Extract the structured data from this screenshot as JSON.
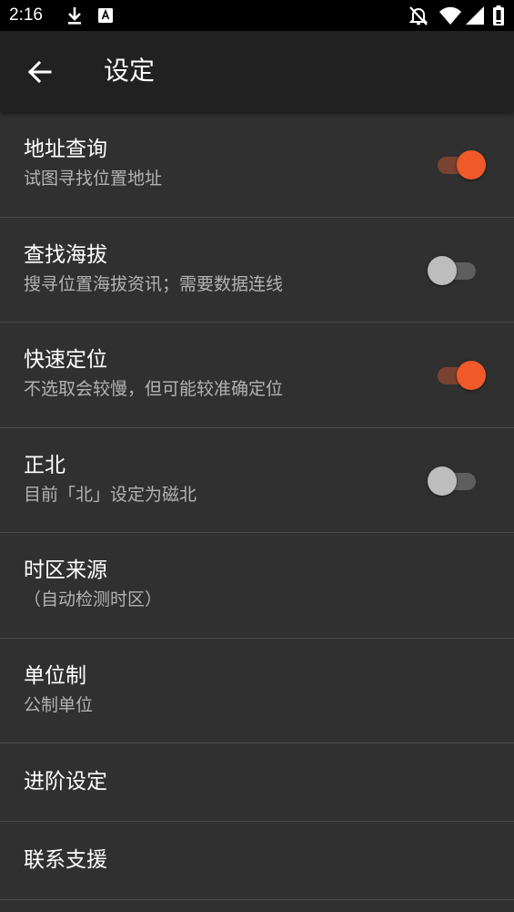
{
  "status_bar": {
    "time": "2:16",
    "left_icons": [
      "download-icon",
      "app-notification-icon"
    ],
    "right_icons": [
      "notifications-off-icon",
      "wifi-icon",
      "signal-icon",
      "battery-icon"
    ]
  },
  "app_bar": {
    "back_icon": "arrow-back-icon",
    "title": "设定"
  },
  "colors": {
    "accent": "#f0592a",
    "accent_track": "#7a4230",
    "background": "#303030",
    "app_bar": "#212121",
    "status_bar": "#000000",
    "divider": "#4a4a4a",
    "secondary_text": "#b3b3b3"
  },
  "settings": [
    {
      "title": "地址查询",
      "summary": "试图寻找位置地址",
      "toggle": true
    },
    {
      "title": "查找海拔",
      "summary": "搜寻位置海拔资讯；需要数据连线",
      "toggle": false
    },
    {
      "title": "快速定位",
      "summary": "不选取会较慢，但可能较准确定位",
      "toggle": true
    },
    {
      "title": "正北",
      "summary": "目前「北」设定为磁北",
      "toggle": false
    },
    {
      "title": "时区来源",
      "summary": "（自动检测时区）"
    },
    {
      "title": "单位制",
      "summary": "公制单位"
    },
    {
      "title": "进阶设定"
    },
    {
      "title": "联系支援"
    }
  ]
}
